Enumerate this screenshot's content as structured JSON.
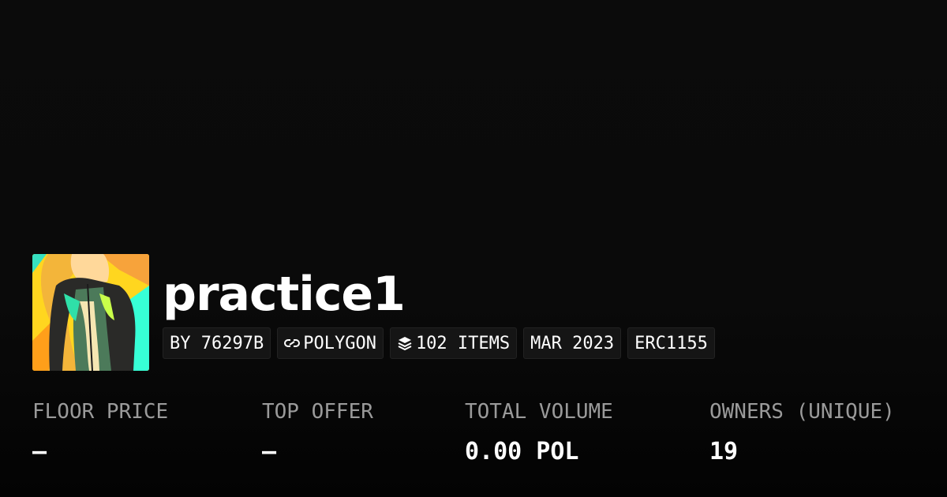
{
  "collection": {
    "name": "practice1",
    "avatar_icon": "collection-avatar-image"
  },
  "badges": [
    {
      "label": "BY 76297B",
      "icon": ""
    },
    {
      "label": "POLYGON",
      "icon": "chain-link-icon"
    },
    {
      "label": "102 ITEMS",
      "icon": "layers-icon"
    },
    {
      "label": "MAR 2023",
      "icon": ""
    },
    {
      "label": "ERC1155",
      "icon": ""
    }
  ],
  "stats": [
    {
      "label": "FLOOR PRICE",
      "value": "–"
    },
    {
      "label": "TOP OFFER",
      "value": "–"
    },
    {
      "label": "TOTAL VOLUME",
      "value": "0.00 POL"
    },
    {
      "label": "OWNERS (UNIQUE)",
      "value": "19"
    }
  ],
  "colors": {
    "background": "#0a0a0a",
    "badge_background": "#151515",
    "label_gray": "#9a9a9a",
    "text": "#ffffff"
  }
}
